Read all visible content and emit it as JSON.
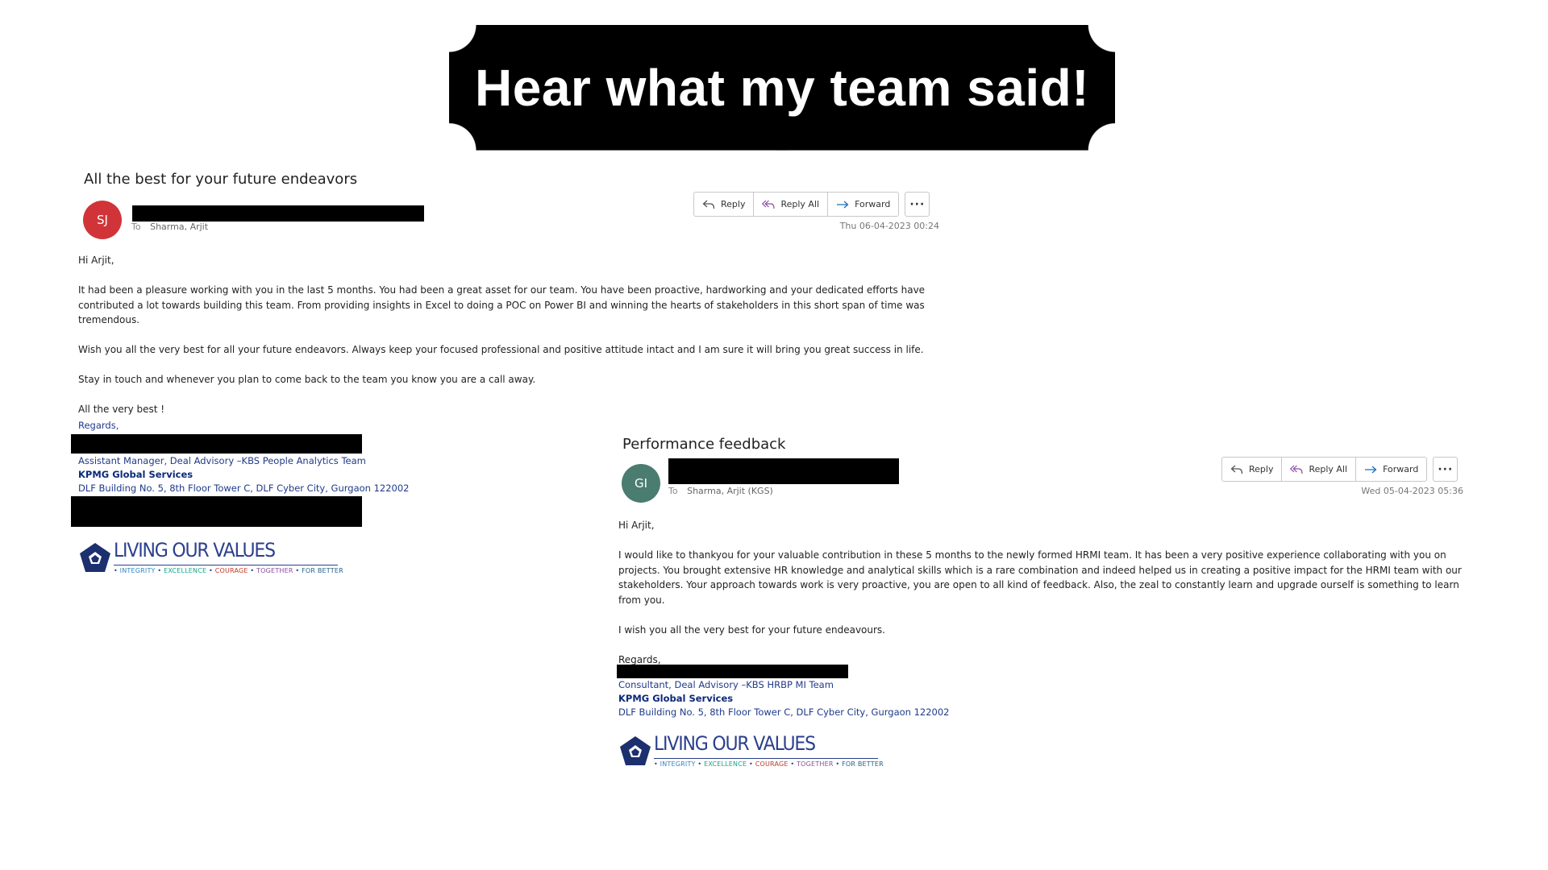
{
  "banner": {
    "title": "Hear what my team said!"
  },
  "email1": {
    "subject": "All the best for your future endeavors",
    "avatar_initials": "SJ",
    "avatar_color": "#d13438",
    "to_label": "To",
    "to_value": "Sharma,  Arjit",
    "actions": {
      "reply": "Reply",
      "reply_all": "Reply All",
      "forward": "Forward",
      "more": "···"
    },
    "date": "Thu 06-04-2023 00:24",
    "greeting": "Hi Arjit,",
    "paragraphs": [
      "It had been a pleasure working with you in the last 5 months. You had been a great asset for our team. You have been proactive, hardworking and your dedicated efforts have contributed a lot towards building this team. From providing insights in Excel to doing a POC on Power BI and winning the hearts of stakeholders in this short span of time was tremendous.",
      "Wish you all the very best for all your future endeavors. Always keep your focused professional and positive attitude intact and I am sure it will bring you great success in life.",
      "Stay in touch and whenever you plan to come back to the team you know you are a call away.",
      "All the very best !"
    ],
    "regards": "Regards,",
    "signature": {
      "role": "Assistant Manager, Deal Advisory –KBS People Analytics Team",
      "company": "KPMG Global Services",
      "address": "DLF Building No. 5, 8th Floor Tower C, DLF Cyber City, Gurgaon 122002"
    }
  },
  "email2": {
    "subject": "Performance feedback",
    "avatar_initials": "GI",
    "avatar_color": "#4a7c6f",
    "to_label": "To",
    "to_value": "Sharma, Arjit (KGS)",
    "actions": {
      "reply": "Reply",
      "reply_all": "Reply All",
      "forward": "Forward",
      "more": "···"
    },
    "date": "Wed 05-04-2023 05:36",
    "greeting": "Hi Arjit,",
    "paragraphs": [
      "I would like to thankyou for your valuable contribution in these 5 months to the newly formed HRMI team. It has been a very positive experience collaborating with you on projects. You brought extensive HR knowledge and analytical skills which is a rare combination and indeed helped us in creating a positive impact for the HRMI team with our stakeholders. Your approach towards work is very proactive, you are open to all kind of feedback. Also, the zeal to constantly learn and upgrade ourself is something to learn from you.",
      "I wish you all the very best for your future endeavours."
    ],
    "regards": "Regards,",
    "signature": {
      "role": "Consultant, Deal Advisory –KBS HRBP MI Team",
      "company": "KPMG Global Services",
      "address": "DLF Building No. 5, 8th Floor Tower C, DLF Cyber City, Gurgaon 122002"
    }
  },
  "logo": {
    "title": "LIVING OUR VALUES",
    "values": [
      "INTEGRITY",
      "EXCELLENCE",
      "COURAGE",
      "TOGETHER",
      "FOR BETTER"
    ]
  },
  "icons": {
    "reply": "reply-arrow-icon",
    "reply_all": "reply-all-arrow-icon",
    "forward": "forward-arrow-icon",
    "logo": "pentagon-logo-icon"
  }
}
